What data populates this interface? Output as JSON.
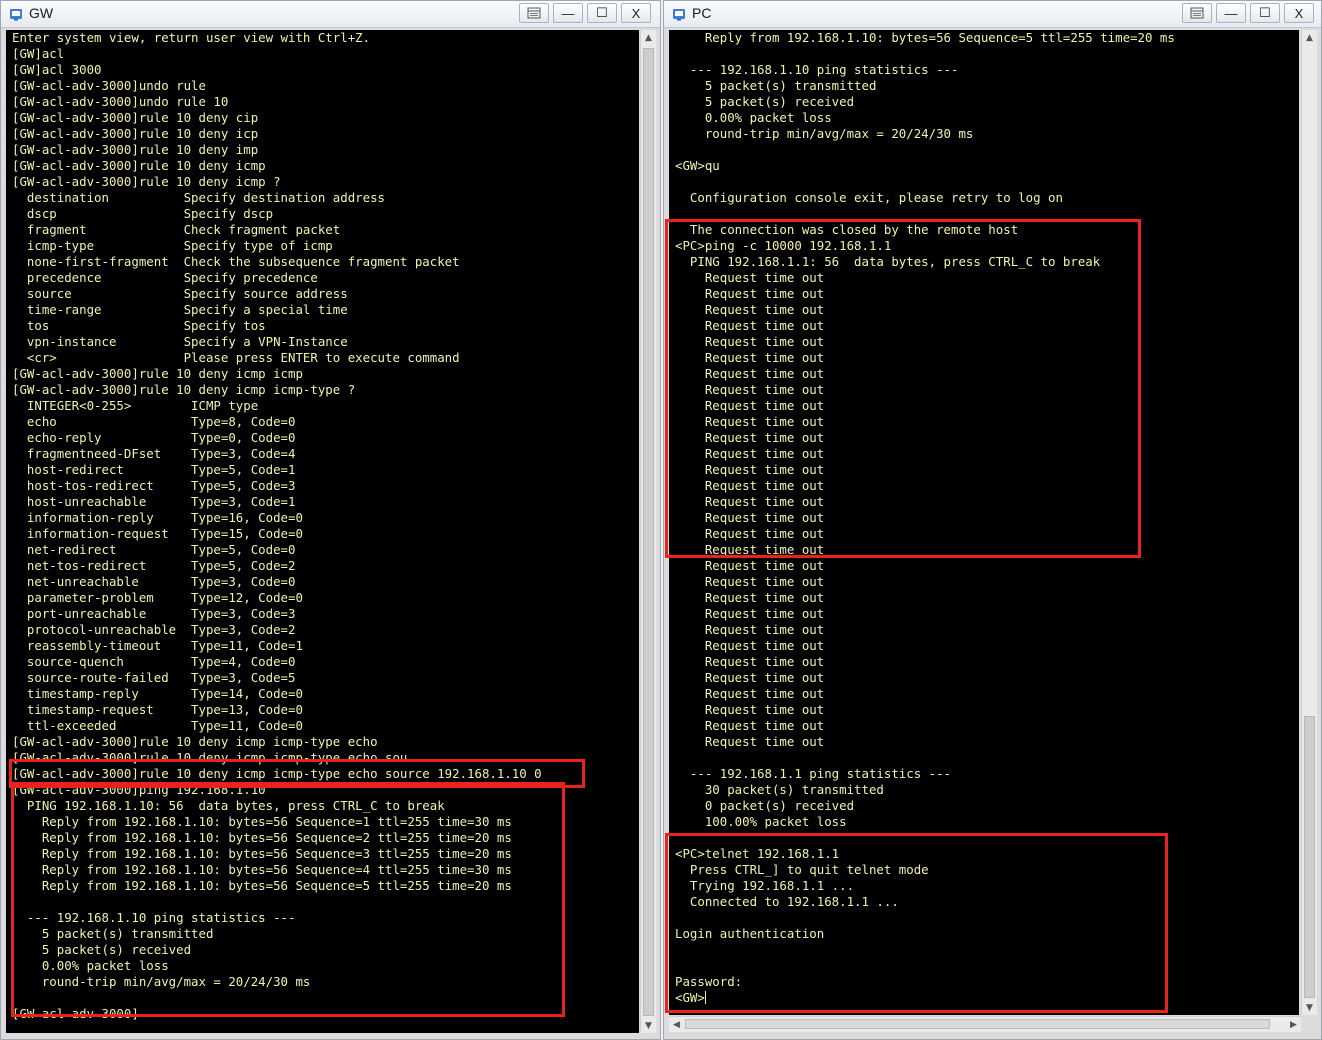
{
  "gw_window": {
    "title": "GW",
    "buttons": {
      "extra": "",
      "minimize": "—",
      "maximize": "☐",
      "close": "X"
    },
    "lines": [
      "Enter system view, return user view with Ctrl+Z.",
      "[GW]acl",
      "[GW]acl 3000",
      "[GW-acl-adv-3000]undo rule",
      "[GW-acl-adv-3000]undo rule 10",
      "[GW-acl-adv-3000]rule 10 deny cip",
      "[GW-acl-adv-3000]rule 10 deny icp",
      "[GW-acl-adv-3000]rule 10 deny imp",
      "[GW-acl-adv-3000]rule 10 deny icmp",
      "[GW-acl-adv-3000]rule 10 deny icmp ?",
      "  destination          Specify destination address",
      "  dscp                 Specify dscp",
      "  fragment             Check fragment packet",
      "  icmp-type            Specify type of icmp",
      "  none-first-fragment  Check the subsequence fragment packet",
      "  precedence           Specify precedence",
      "  source               Specify source address",
      "  time-range           Specify a special time",
      "  tos                  Specify tos",
      "  vpn-instance         Specify a VPN-Instance",
      "  <cr>                 Please press ENTER to execute command",
      "[GW-acl-adv-3000]rule 10 deny icmp icmp",
      "[GW-acl-adv-3000]rule 10 deny icmp icmp-type ?",
      "  INTEGER<0-255>        ICMP type",
      "  echo                  Type=8, Code=0",
      "  echo-reply            Type=0, Code=0",
      "  fragmentneed-DFset    Type=3, Code=4",
      "  host-redirect         Type=5, Code=1",
      "  host-tos-redirect     Type=5, Code=3",
      "  host-unreachable      Type=3, Code=1",
      "  information-reply     Type=16, Code=0",
      "  information-request   Type=15, Code=0",
      "  net-redirect          Type=5, Code=0",
      "  net-tos-redirect      Type=5, Code=2",
      "  net-unreachable       Type=3, Code=0",
      "  parameter-problem     Type=12, Code=0",
      "  port-unreachable      Type=3, Code=3",
      "  protocol-unreachable  Type=3, Code=2",
      "  reassembly-timeout    Type=11, Code=1",
      "  source-quench         Type=4, Code=0",
      "  source-route-failed   Type=3, Code=5",
      "  timestamp-reply       Type=14, Code=0",
      "  timestamp-request     Type=13, Code=0",
      "  ttl-exceeded          Type=11, Code=0",
      "[GW-acl-adv-3000]rule 10 deny icmp icmp-type echo",
      "[GW-acl-adv-3000]rule 10 deny icmp icmp-type echo sou",
      "[GW-acl-adv-3000]rule 10 deny icmp icmp-type echo source 192.168.1.10 0",
      "[GW-acl-adv-3000]ping 192.168.1.10",
      "  PING 192.168.1.10: 56  data bytes, press CTRL_C to break",
      "    Reply from 192.168.1.10: bytes=56 Sequence=1 ttl=255 time=30 ms",
      "    Reply from 192.168.1.10: bytes=56 Sequence=2 ttl=255 time=20 ms",
      "    Reply from 192.168.1.10: bytes=56 Sequence=3 ttl=255 time=20 ms",
      "    Reply from 192.168.1.10: bytes=56 Sequence=4 ttl=255 time=30 ms",
      "    Reply from 192.168.1.10: bytes=56 Sequence=5 ttl=255 time=20 ms",
      "",
      "  --- 192.168.1.10 ping statistics ---",
      "    5 packet(s) transmitted",
      "    5 packet(s) received",
      "    0.00% packet loss",
      "    round-trip min/avg/max = 20/24/30 ms",
      "",
      "[GW-acl-adv-3000]"
    ]
  },
  "pc_window": {
    "title": "PC",
    "buttons": {
      "extra": "",
      "minimize": "—",
      "maximize": "☐",
      "close": "X"
    },
    "lines": [
      "    Reply from 192.168.1.10: bytes=56 Sequence=5 ttl=255 time=20 ms",
      "",
      "  --- 192.168.1.10 ping statistics ---",
      "    5 packet(s) transmitted",
      "    5 packet(s) received",
      "    0.00% packet loss",
      "    round-trip min/avg/max = 20/24/30 ms",
      "",
      "<GW>qu",
      "",
      "  Configuration console exit, please retry to log on",
      "",
      "  The connection was closed by the remote host",
      "<PC>ping -c 10000 192.168.1.1",
      "  PING 192.168.1.1: 56  data bytes, press CTRL_C to break",
      "    Request time out",
      "    Request time out",
      "    Request time out",
      "    Request time out",
      "    Request time out",
      "    Request time out",
      "    Request time out",
      "    Request time out",
      "    Request time out",
      "    Request time out",
      "    Request time out",
      "    Request time out",
      "    Request time out",
      "    Request time out",
      "    Request time out",
      "    Request time out",
      "    Request time out",
      "    Request time out",
      "    Request time out",
      "    Request time out",
      "    Request time out",
      "    Request time out",
      "    Request time out",
      "    Request time out",
      "    Request time out",
      "    Request time out",
      "    Request time out",
      "    Request time out",
      "    Request time out",
      "    Request time out",
      "",
      "  --- 192.168.1.1 ping statistics ---",
      "    30 packet(s) transmitted",
      "    0 packet(s) received",
      "    100.00% packet loss",
      "",
      "<PC>telnet 192.168.1.1",
      "  Press CTRL_] to quit telnet mode",
      "  Trying 192.168.1.1 ...",
      "  Connected to 192.168.1.1 ...",
      "",
      "Login authentication",
      "",
      "",
      "Password:",
      "<GW>"
    ]
  },
  "scrollbar_arrows": {
    "up": "▲",
    "down": "▼",
    "left": "◀",
    "right": "▶"
  },
  "colors": {
    "terminal_bg": "#000000",
    "terminal_text": "#f2f2a8",
    "highlight_box": "#e8231c"
  }
}
